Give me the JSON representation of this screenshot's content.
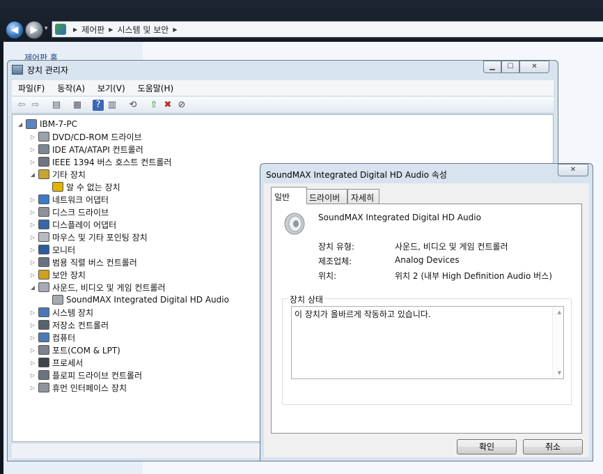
{
  "explorer": {
    "breadcrumb": [
      "제어판",
      "시스템 및 보안"
    ],
    "home_label": "제어판 홈"
  },
  "device_manager": {
    "title": "장치 관리자",
    "menu": [
      "파일(F)",
      "동작(A)",
      "보기(V)",
      "도움말(H)"
    ],
    "tree": {
      "root": "IBM-7-PC",
      "items": [
        {
          "label": "DVD/CD-ROM 드라이브",
          "expander": "closed",
          "icon": "cdrom-icon"
        },
        {
          "label": "IDE ATA/ATAPI 컨트롤러",
          "expander": "closed",
          "icon": "ide-controller-icon"
        },
        {
          "label": "IEEE 1394 버스 호스트 컨트롤러",
          "expander": "closed",
          "icon": "firewire-icon"
        },
        {
          "label": "기타 장치",
          "expander": "open",
          "icon": "other-devices-icon"
        },
        {
          "label": "알 수 없는 장치",
          "expander": "none",
          "icon": "unknown-device-warning-icon",
          "indent": true
        },
        {
          "label": "네트워크 어댑터",
          "expander": "closed",
          "icon": "network-adapter-icon"
        },
        {
          "label": "디스크 드라이브",
          "expander": "closed",
          "icon": "disk-drive-icon"
        },
        {
          "label": "디스플레이 어댑터",
          "expander": "closed",
          "icon": "display-adapter-icon"
        },
        {
          "label": "마우스 및 기타 포인팅 장치",
          "expander": "closed",
          "icon": "mouse-icon"
        },
        {
          "label": "모니터",
          "expander": "closed",
          "icon": "monitor-icon"
        },
        {
          "label": "범용 직렬 버스 컨트롤러",
          "expander": "closed",
          "icon": "usb-icon"
        },
        {
          "label": "보안 장치",
          "expander": "closed",
          "icon": "security-key-icon"
        },
        {
          "label": "사운드, 비디오 및 게임 컨트롤러",
          "expander": "open",
          "icon": "speaker-icon"
        },
        {
          "label": "SoundMAX Integrated Digital HD Audio",
          "expander": "none",
          "icon": "speaker-icon",
          "indent": true
        },
        {
          "label": "시스템 장치",
          "expander": "closed",
          "icon": "system-devices-icon"
        },
        {
          "label": "저장소 컨트롤러",
          "expander": "closed",
          "icon": "storage-controller-icon"
        },
        {
          "label": "컴퓨터",
          "expander": "closed",
          "icon": "computer-icon"
        },
        {
          "label": "포트(COM & LPT)",
          "expander": "closed",
          "icon": "port-icon"
        },
        {
          "label": "프로세서",
          "expander": "closed",
          "icon": "processor-icon"
        },
        {
          "label": "플로피 드라이브 컨트롤러",
          "expander": "closed",
          "icon": "floppy-controller-icon"
        },
        {
          "label": "휴먼 인터페이스 장치",
          "expander": "closed",
          "icon": "hid-icon"
        }
      ]
    }
  },
  "properties": {
    "title": "SoundMAX Integrated Digital HD Audio 속성",
    "tabs": [
      "일반",
      "드라이버",
      "자세히"
    ],
    "device_name": "SoundMAX Integrated Digital HD Audio",
    "fields": [
      {
        "label": "장치 유형:",
        "value": "사운드, 비디오 및 게임 컨트롤러"
      },
      {
        "label": "제조업체:",
        "value": "Analog Devices"
      },
      {
        "label": "위치:",
        "value": "위치 2 (내부 High Definition Audio 버스)"
      }
    ],
    "status_group_label": "장치 상태",
    "status_text": "이 장치가 올바르게 작동하고 있습니다.",
    "ok_label": "확인",
    "cancel_label": "취소"
  }
}
